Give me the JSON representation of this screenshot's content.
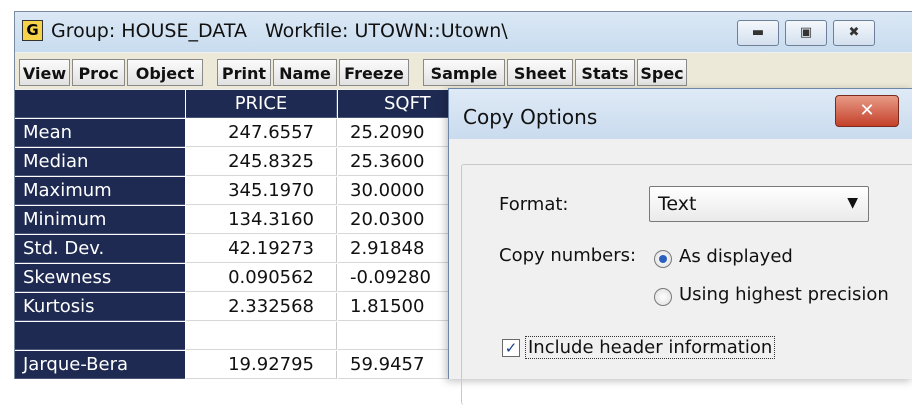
{
  "window": {
    "icon_letter": "G",
    "title_group": "Group: HOUSE_DATA",
    "title_workfile": "Workfile: UTOWN::Utown\\",
    "controls": [
      "minimize-icon",
      "maximize-icon",
      "close-icon"
    ]
  },
  "toolbar": [
    "View",
    "Proc",
    "Object",
    "Print",
    "Name",
    "Freeze",
    "Sample",
    "Sheet",
    "Stats",
    "Spec"
  ],
  "table": {
    "columns": [
      "",
      "PRICE",
      "SQFT"
    ],
    "rows": [
      {
        "label": "Mean",
        "price": "247.6557",
        "sqft": "25.2090"
      },
      {
        "label": "Median",
        "price": "245.8325",
        "sqft": "25.3600"
      },
      {
        "label": "Maximum",
        "price": "345.1970",
        "sqft": "30.0000"
      },
      {
        "label": "Minimum",
        "price": "134.3160",
        "sqft": "20.0300"
      },
      {
        "label": "Std. Dev.",
        "price": "42.19273",
        "sqft": "2.91848"
      },
      {
        "label": "Skewness",
        "price": "0.090562",
        "sqft": "-0.09280"
      },
      {
        "label": "Kurtosis",
        "price": "2.332568",
        "sqft": "1.81500"
      },
      {
        "label": "",
        "price": "",
        "sqft": ""
      },
      {
        "label": "Jarque-Bera",
        "price": "19.92795",
        "sqft": "59.9457"
      }
    ]
  },
  "dialog": {
    "title": "Copy Options",
    "format_label": "Format:",
    "format_value": "Text",
    "numbers_label": "Copy numbers:",
    "opt_displayed": "As displayed",
    "opt_highest": "Using highest precision",
    "header_label": "Include header information",
    "header_checked": true
  }
}
